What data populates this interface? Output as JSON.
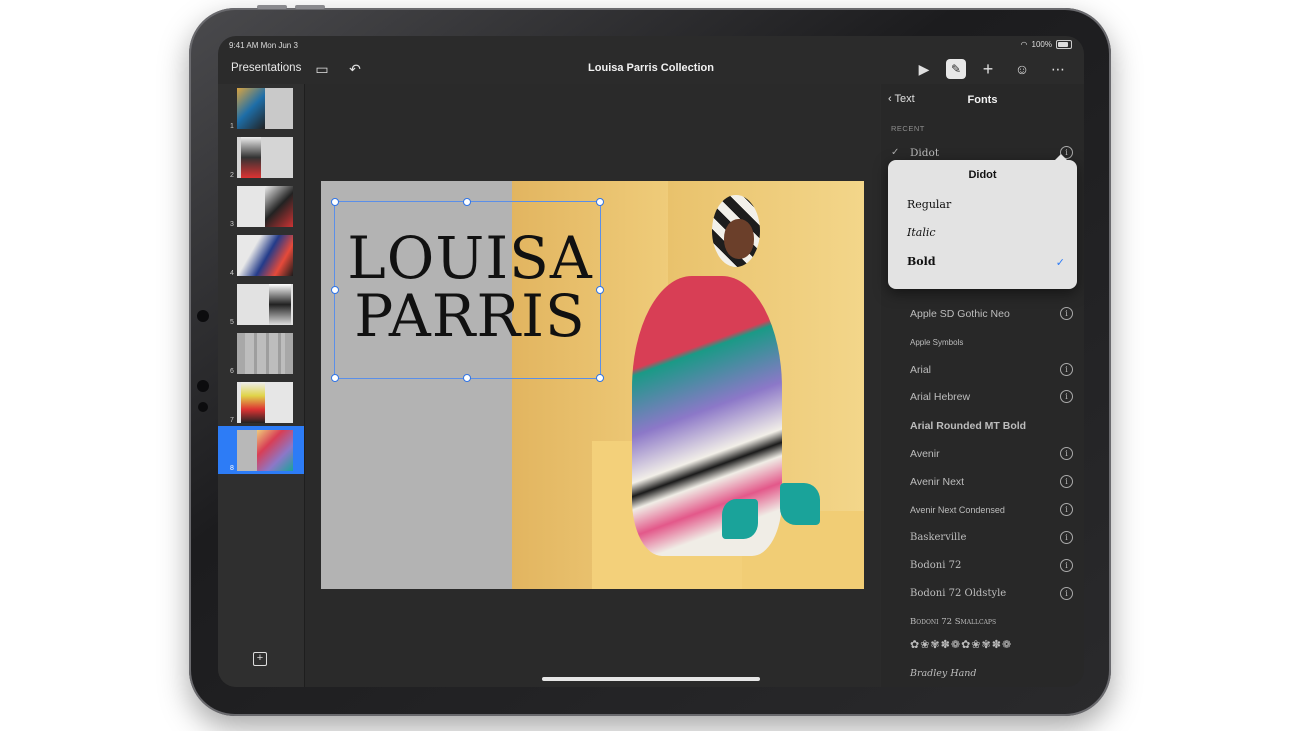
{
  "status_bar": {
    "time": "9:41 AM  Mon Jun 3",
    "battery": "100%"
  },
  "toolbar": {
    "back_label": "Presentations",
    "title": "Louisa Parris Collection"
  },
  "navigator": {
    "slides": [
      "1",
      "2",
      "3",
      "4",
      "5",
      "6",
      "7",
      "8"
    ],
    "selected": "8"
  },
  "slide": {
    "headline_line1": "LOUISA",
    "headline_line2": "PARRIS"
  },
  "fonts_panel": {
    "back_label": "Text",
    "title": "Fonts",
    "section_recent": "RECENT",
    "recent_font": "Didot",
    "fonts": [
      "Apple SD Gothic Neo",
      "Apple Symbols",
      "Arial",
      "Arial Hebrew",
      "Arial Rounded MT Bold",
      "Avenir",
      "Avenir Next",
      "Avenir Next Condensed",
      "Baskerville",
      "Bodoni 72",
      "Bodoni 72 Oldstyle",
      "Bodoni 72 Smallcaps",
      "Bradley Hand"
    ]
  },
  "popover": {
    "title": "Didot",
    "styles": [
      "Regular",
      "Italic",
      "Bold"
    ],
    "selected": "Bold"
  },
  "colors": {
    "accent": "#2d7cf6",
    "panel": "#282828",
    "canvas": "#2a2a2a"
  }
}
